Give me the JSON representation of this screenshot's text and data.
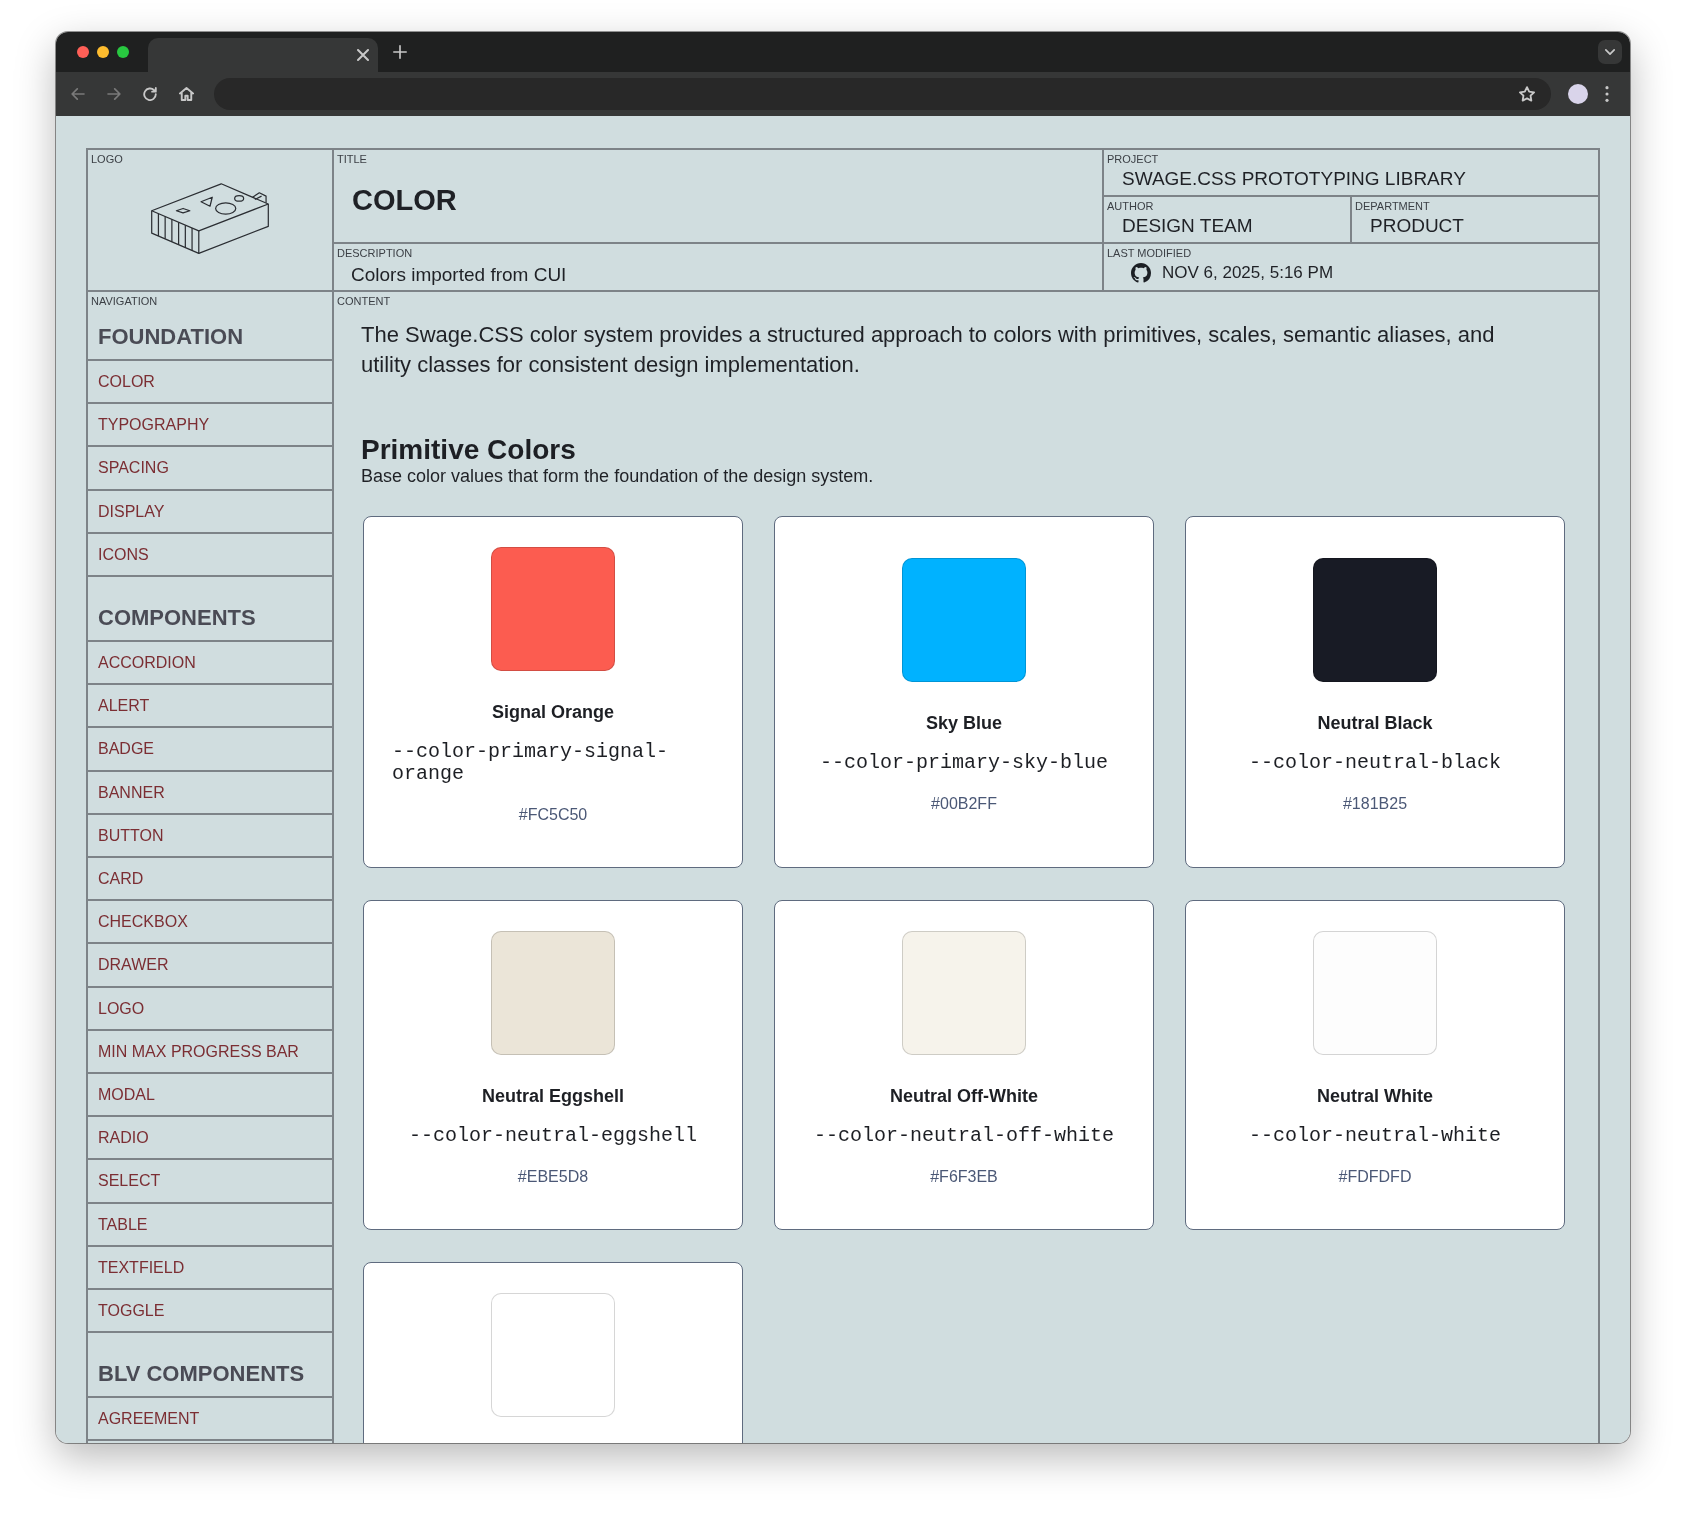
{
  "browser": {
    "tabs": [
      {
        "selected": true
      }
    ],
    "toolbar_buttons": [
      {
        "kind": "back",
        "disabled": true
      },
      {
        "kind": "forward",
        "disabled": true
      },
      {
        "kind": "reload",
        "disabled": false
      },
      {
        "kind": "home",
        "disabled": false
      }
    ]
  },
  "header": {
    "logo_label": "LOGO",
    "title_label": "TITLE",
    "title": "COLOR",
    "project_label": "PROJECT",
    "project": "SWAGE.CSS PROTOTYPING LIBRARY",
    "author_label": "AUTHOR",
    "author": "DESIGN TEAM",
    "department_label": "DEPARTMENT",
    "department": "PRODUCT",
    "description_label": "DESCRIPTION",
    "description": "Colors imported from CUI",
    "last_modified_label": "LAST MODIFIED",
    "last_modified": "NOV 6, 2025, 5:16 PM"
  },
  "navigation": {
    "label": "NAVIGATION",
    "sections": [
      {
        "heading": "FOUNDATION",
        "items": [
          "COLOR",
          "TYPOGRAPHY",
          "SPACING",
          "DISPLAY",
          "ICONS"
        ]
      },
      {
        "heading": "COMPONENTS",
        "items": [
          "ACCORDION",
          "ALERT",
          "BADGE",
          "BANNER",
          "BUTTON",
          "CARD",
          "CHECKBOX",
          "DRAWER",
          "LOGO",
          "MIN MAX PROGRESS BAR",
          "MODAL",
          "RADIO",
          "SELECT",
          "TABLE",
          "TEXTFIELD",
          "TOGGLE"
        ]
      },
      {
        "heading": "BLV COMPONENTS",
        "items": [
          "AGREEMENT"
        ]
      }
    ]
  },
  "content": {
    "label": "CONTENT",
    "intro": "The Swage.CSS color system provides a structured approach to colors with primitives, scales, semantic aliases, and utility classes for consistent design implementation.",
    "section": {
      "title": "Primitive Colors",
      "subtitle": "Base color values that form the foundation of the design system.",
      "swatches": [
        {
          "name": "Signal Orange",
          "variable": "--color-primary-signal-orange",
          "hex": "#FC5C50",
          "color": "#fc5c50"
        },
        {
          "name": "Sky Blue",
          "variable": "--color-primary-sky-blue",
          "hex": "#00B2FF",
          "color": "#00b2ff"
        },
        {
          "name": "Neutral Black",
          "variable": "--color-neutral-black",
          "hex": "#181B25",
          "color": "#181b25"
        },
        {
          "name": "Neutral Eggshell",
          "variable": "--color-neutral-eggshell",
          "hex": "#EBE5D8",
          "color": "#ebe5d8"
        },
        {
          "name": "Neutral Off-White",
          "variable": "--color-neutral-off-white",
          "hex": "#F6F3EB",
          "color": "#f6f3eb"
        },
        {
          "name": "Neutral White",
          "variable": "--color-neutral-white",
          "hex": "#FDFDFD",
          "color": "#fdfdfd"
        },
        {
          "color": "#ffffff"
        }
      ]
    }
  }
}
